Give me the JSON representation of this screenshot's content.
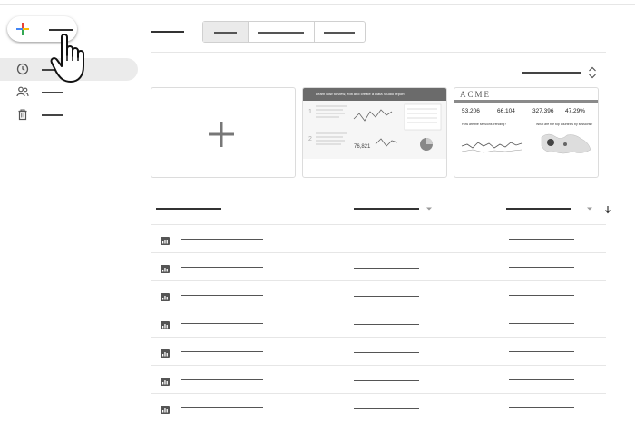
{
  "app": {
    "create_label": "",
    "nav": [
      {
        "id": "recent",
        "icon": "clock-icon",
        "label": "",
        "active": true
      },
      {
        "id": "shared",
        "icon": "people-icon",
        "label": "",
        "active": false
      },
      {
        "id": "trash",
        "icon": "trash-icon",
        "label": "",
        "active": false
      }
    ]
  },
  "main": {
    "section_title": "",
    "tabs": [
      "",
      "",
      ""
    ],
    "sort_label": ""
  },
  "templates": {
    "tutorial": {
      "header": "Learn how to view, edit and create a Data Studio report"
    },
    "acme": {
      "logo": "ACME",
      "kpis": [
        "53,206",
        "66,104",
        "327,396",
        "47.29%"
      ],
      "q1": "How are the sessions trending?",
      "q2": "What are the top countries by sessions?"
    }
  },
  "colors": {
    "google_blue": "#4285F4",
    "google_red": "#EA4335",
    "google_yellow": "#FBBC05",
    "google_green": "#34A853",
    "nav_active_bg": "#ebebeb"
  },
  "table": {
    "headers": [
      "",
      "",
      ""
    ],
    "rows": [
      {
        "icon": "report-icon",
        "name": "",
        "owner": "",
        "opened": ""
      },
      {
        "icon": "report-icon",
        "name": "",
        "owner": "",
        "opened": ""
      },
      {
        "icon": "report-icon",
        "name": "",
        "owner": "",
        "opened": ""
      },
      {
        "icon": "report-icon",
        "name": "",
        "owner": "",
        "opened": ""
      },
      {
        "icon": "report-icon",
        "name": "",
        "owner": "",
        "opened": ""
      },
      {
        "icon": "report-icon",
        "name": "",
        "owner": "",
        "opened": ""
      },
      {
        "icon": "report-icon",
        "name": "",
        "owner": "",
        "opened": ""
      }
    ]
  }
}
